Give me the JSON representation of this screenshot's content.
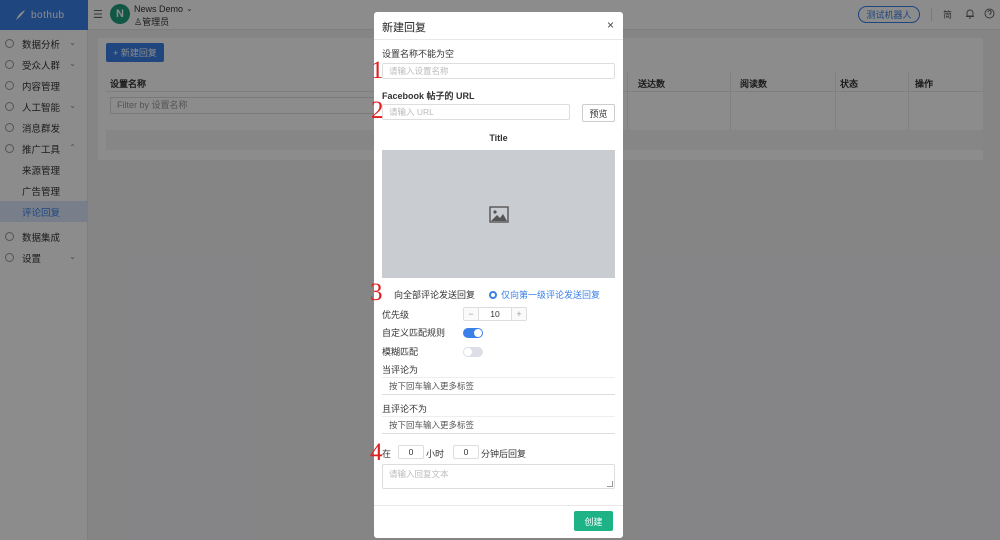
{
  "topbar": {
    "logo_text": "bothub",
    "avatar_letter": "N",
    "app_name": "News Demo",
    "app_role": "管理员",
    "test_bot_label": "测试机器人",
    "lang_label": "简"
  },
  "sidebar": {
    "items": [
      {
        "label": "数据分析",
        "has_chevron": true
      },
      {
        "label": "受众人群",
        "has_chevron": true
      },
      {
        "label": "内容管理",
        "has_chevron": false
      },
      {
        "label": "人工智能",
        "has_chevron": true
      },
      {
        "label": "消息群发",
        "has_chevron": false
      },
      {
        "label": "推广工具",
        "has_chevron": true
      },
      {
        "label": "来源管理",
        "sub": true
      },
      {
        "label": "广告管理",
        "sub": true
      },
      {
        "label": "评论回复",
        "sub": true,
        "active": true
      },
      {
        "label": "数据集成",
        "has_chevron": false
      },
      {
        "label": "设置",
        "has_chevron": true
      }
    ]
  },
  "main": {
    "new_button": "+ 新建回复",
    "columns": [
      "设置名称",
      "送达数",
      "阅读数",
      "状态",
      "操作"
    ],
    "filter_placeholder": "Filter by 设置名称"
  },
  "modal": {
    "title": "新建回复",
    "close": "×",
    "name_label": "设置名称不能为空",
    "name_placeholder": "请输入设置名称",
    "url_label": "Facebook 帖子的 URL",
    "url_placeholder": "请输入 URL",
    "preview_button": "预览",
    "card_title": "Title",
    "reply_scope": {
      "options": [
        "向全部评论发送回复",
        "仅向第一级评论发送回复"
      ],
      "selected_index": 1
    },
    "priority_label": "优先级",
    "priority_value": "10",
    "custom_rule_label": "自定义匹配规则",
    "custom_rule_on": true,
    "fuzzy_label": "模糊匹配",
    "fuzzy_on": false,
    "comment_is_label": "当评论为",
    "comment_is_placeholder": "按下回车输入更多标签",
    "comment_not_label": "且评论不为",
    "comment_not_placeholder": "按下回车输入更多标签",
    "delay_prefix": "在",
    "delay_hours": "0",
    "delay_hours_unit": "小时",
    "delay_minutes": "0",
    "delay_suffix": "分钟后回复",
    "reply_placeholder": "请输入回复文本",
    "create_button": "创建"
  },
  "annotations": [
    "1",
    "2",
    "3",
    "4"
  ],
  "colors": {
    "primary": "#3a80e8",
    "success": "#1eb386",
    "annotation": "#e02020"
  }
}
